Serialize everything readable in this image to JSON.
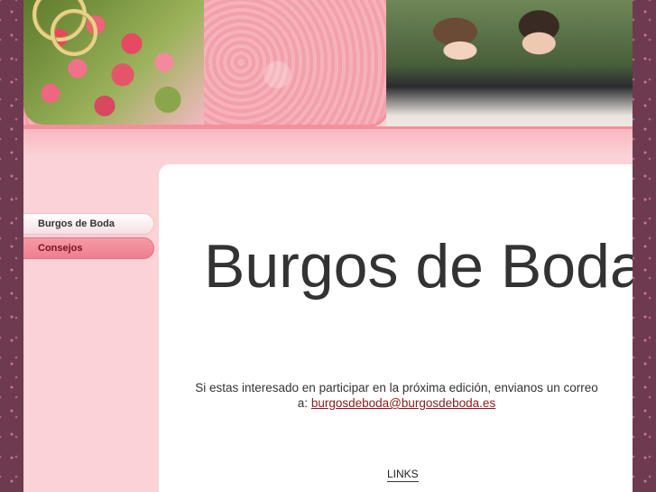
{
  "nav": {
    "items": [
      {
        "label": "Burgos de Boda",
        "active": false
      },
      {
        "label": "Consejos",
        "active": true
      }
    ]
  },
  "main": {
    "title": "Burgos de Boda",
    "info_text": "Si estas interesado en participar en la próxima edición, envianos un correo a:",
    "email": "burgosdeboda@burgosdeboda.es",
    "links_label": "LINKS"
  },
  "colors": {
    "page_bg": "#fbd2d6",
    "outer_bg": "#6e3a4f",
    "accent": "#f58f9c",
    "link": "#8b1a1a"
  }
}
